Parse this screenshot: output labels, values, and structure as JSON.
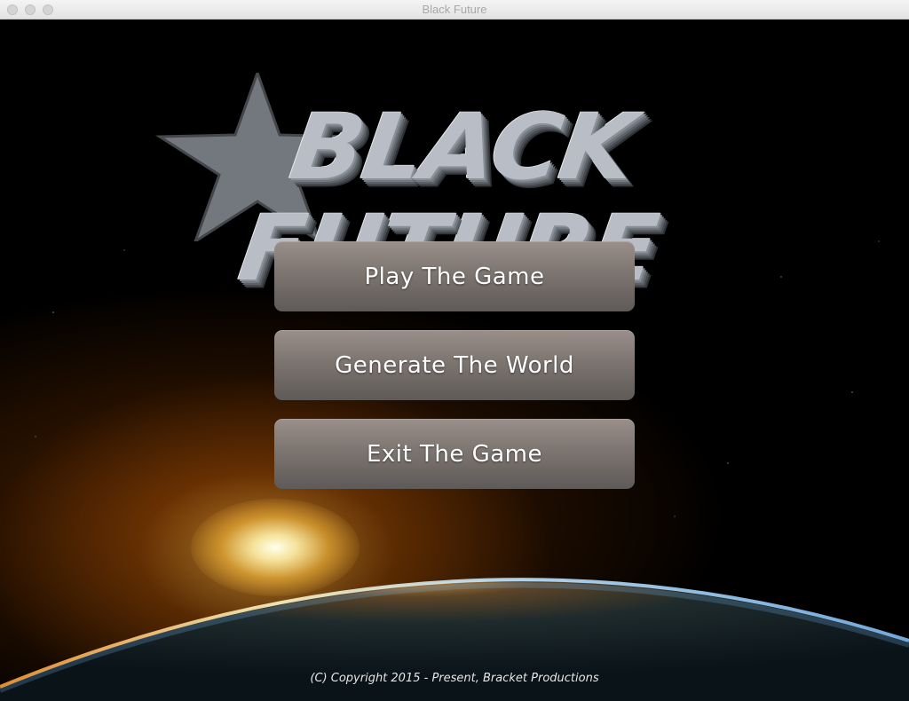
{
  "window": {
    "title": "Black Future",
    "controls": [
      "close",
      "minimize",
      "maximize"
    ]
  },
  "logo": {
    "text": "BLACK FUTURE",
    "color": "#b9bec6"
  },
  "menu": {
    "items": [
      {
        "label": "Play The Game"
      },
      {
        "label": "Generate The World"
      },
      {
        "label": "Exit The Game"
      }
    ],
    "button_color": "#7d7570",
    "text_color": "#ffffff"
  },
  "footer": {
    "copyright": "(C) Copyright 2015 - Present, Bracket Productions"
  },
  "background": {
    "scene": "earth-horizon-sunrise",
    "sun_color": "#ffd060"
  }
}
